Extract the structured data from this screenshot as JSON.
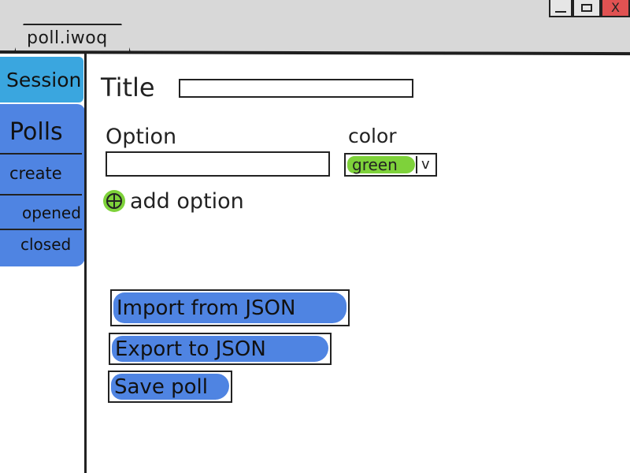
{
  "window": {
    "tab_title": "poll.iwoq",
    "controls": {
      "minimize_icon": "minimize-icon",
      "maximize_icon": "maximize-icon",
      "close_icon": "close-icon",
      "close_glyph": "X"
    }
  },
  "sidebar": {
    "session_label": "Session",
    "polls_heading": "Polls",
    "items": [
      {
        "label": "create"
      },
      {
        "label": "opened"
      },
      {
        "label": "closed"
      }
    ]
  },
  "form": {
    "title_label": "Title",
    "title_value": "",
    "option_label": "Option",
    "option_value": "",
    "color_label": "color",
    "color_selected": "green",
    "color_caret": "v",
    "add_option_label": "add option"
  },
  "actions": {
    "import_label": "Import from JSON",
    "export_label": "Export to JSON",
    "save_label": "Save poll"
  },
  "colors": {
    "sidebar_blue": "#4f84e2",
    "session_blue": "#3aa6df",
    "accent_green": "#7ed23a",
    "close_red": "#e05252"
  }
}
